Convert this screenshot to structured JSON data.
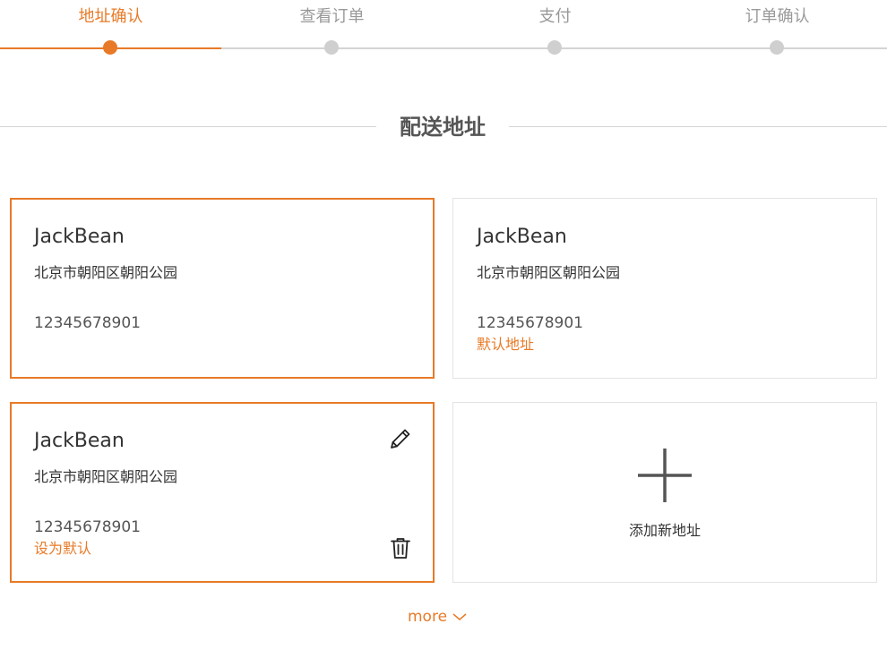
{
  "steps": [
    {
      "label": "地址确认",
      "active": true
    },
    {
      "label": "查看订单",
      "active": false
    },
    {
      "label": "支付",
      "active": false
    },
    {
      "label": "订单确认",
      "active": false
    }
  ],
  "section": {
    "title": "配送地址"
  },
  "addresses": [
    {
      "name": "JackBean",
      "address": "北京市朝阳区朝阳公园",
      "phone": "12345678901",
      "tag": "",
      "selected": true
    },
    {
      "name": "JackBean",
      "address": "北京市朝阳区朝阳公园",
      "phone": "12345678901",
      "tag": "默认地址",
      "selected": false
    },
    {
      "name": "JackBean",
      "address": "北京市朝阳区朝阳公园",
      "phone": "12345678901",
      "tag": "设为默认",
      "selected": true,
      "actions": [
        "pencil-icon",
        "trash-icon"
      ]
    }
  ],
  "add_address": {
    "label": "添加新地址",
    "icon": "plus-icon"
  },
  "more": {
    "label": "more",
    "icon": "chevron-down-icon"
  },
  "colors": {
    "accent": "#e87a27",
    "inactive": "#cfcfcf",
    "border": "#e3e3e3"
  }
}
